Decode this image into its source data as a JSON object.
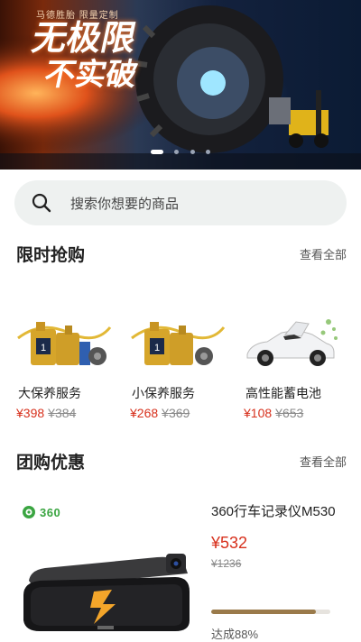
{
  "banner": {
    "subtitle": "马德胜胎  限量定制",
    "headline_1": "无极限",
    "headline_2": "不实破",
    "dots": [
      true,
      false,
      false,
      false
    ]
  },
  "search": {
    "placeholder": "搜索你想要的商品"
  },
  "flash_sale": {
    "title": "限时抢购",
    "more": "查看全部",
    "items": [
      {
        "name": "大保养服务",
        "price": "¥398",
        "original": "¥384",
        "image": "oil-bottles-icon"
      },
      {
        "name": "小保养服务",
        "price": "¥268",
        "original": "¥369",
        "image": "oil-bottles-icon"
      },
      {
        "name": "高性能蓄电池",
        "price": "¥108",
        "original": "¥653",
        "image": "white-car-icon"
      }
    ]
  },
  "group_buy": {
    "title": "团购优惠",
    "more": "查看全部",
    "brand": "360",
    "product": {
      "name": "360行车记录仪M530",
      "price": "¥532",
      "original": "¥1236",
      "progress_label": "达成88%",
      "progress": 0.88
    }
  },
  "colors": {
    "price_red": "#d7301c",
    "progress_gold": "#9a7a4a",
    "brand_green": "#3aa541"
  }
}
